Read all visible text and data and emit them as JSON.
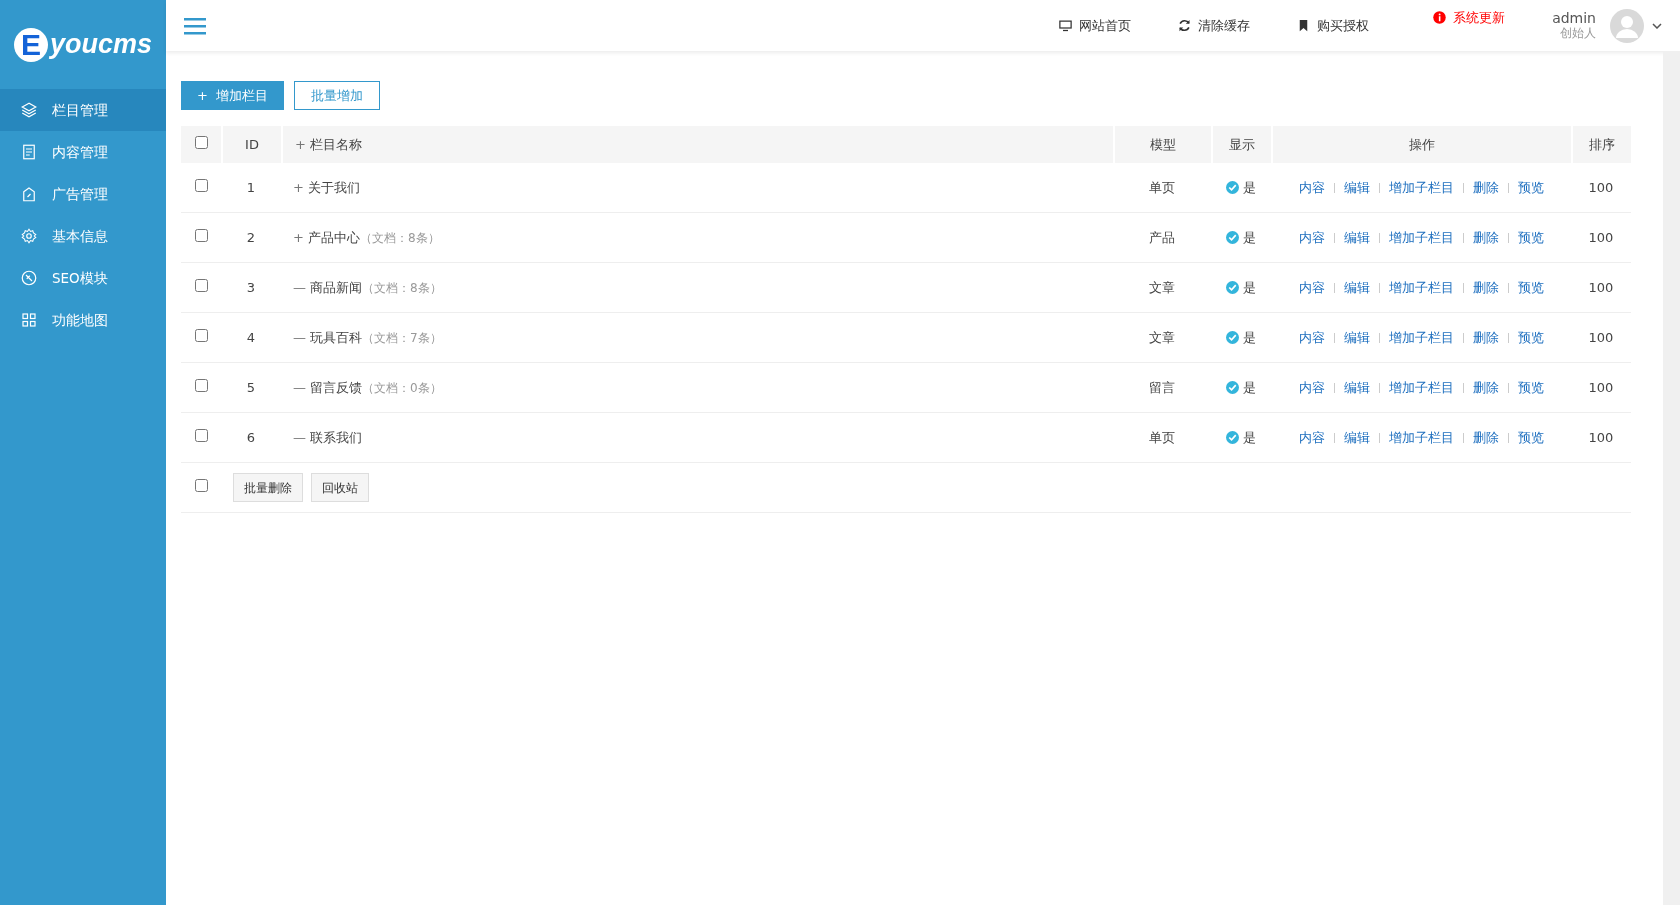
{
  "logo": {
    "initial": "E",
    "text": "youcms"
  },
  "sidebar": {
    "items": [
      {
        "label": "栏目管理",
        "selected": true
      },
      {
        "label": "内容管理",
        "selected": false
      },
      {
        "label": "广告管理",
        "selected": false
      },
      {
        "label": "基本信息",
        "selected": false
      },
      {
        "label": "SEO模块",
        "selected": false
      },
      {
        "label": "功能地图",
        "selected": false
      }
    ]
  },
  "topbar": {
    "links": [
      {
        "label": "网站首页",
        "kind": "normal"
      },
      {
        "label": "清除缓存",
        "kind": "normal"
      },
      {
        "label": "购买授权",
        "kind": "normal"
      },
      {
        "label": "系统更新",
        "kind": "alert"
      }
    ],
    "user": {
      "name": "admin",
      "role": "创始人"
    }
  },
  "toolbar": {
    "buttons": [
      {
        "label": "增加栏目",
        "prefix": "+",
        "kind": "primary"
      },
      {
        "label": "批量增加",
        "kind": "outline"
      }
    ]
  },
  "table": {
    "select_all_checked": false,
    "footer_checked": false,
    "columns": [
      "ID",
      "栏目名称",
      "模型",
      "显示",
      "操作",
      "排序"
    ],
    "name_toggle": "+",
    "rows": [
      {
        "checked": false,
        "id": "1",
        "toggle": "+",
        "name": "关于我们",
        "model": "单页",
        "show": "是",
        "actions": [
          "内容",
          "编辑",
          "增加子栏目",
          "删除",
          "预览"
        ],
        "sort": "100"
      },
      {
        "checked": false,
        "id": "2",
        "toggle": "+",
        "name": "产品中心",
        "count": "（文档：8条）",
        "model": "产品",
        "show": "是",
        "actions": [
          "内容",
          "编辑",
          "增加子栏目",
          "删除",
          "预览"
        ],
        "sort": "100"
      },
      {
        "checked": false,
        "id": "3",
        "toggle": "—",
        "name": "商品新闻",
        "count": "（文档：8条）",
        "model": "文章",
        "show": "是",
        "actions": [
          "内容",
          "编辑",
          "增加子栏目",
          "删除",
          "预览"
        ],
        "sort": "100"
      },
      {
        "checked": false,
        "id": "4",
        "toggle": "—",
        "name": "玩具百科",
        "count": "（文档：7条）",
        "model": "文章",
        "show": "是",
        "actions": [
          "内容",
          "编辑",
          "增加子栏目",
          "删除",
          "预览"
        ],
        "sort": "100"
      },
      {
        "checked": false,
        "id": "5",
        "toggle": "—",
        "name": "留言反馈",
        "count": "（文档：0条）",
        "model": "留言",
        "show": "是",
        "actions": [
          "内容",
          "编辑",
          "增加子栏目",
          "删除",
          "预览"
        ],
        "sort": "100"
      },
      {
        "checked": false,
        "id": "6",
        "toggle": "—",
        "name": "联系我们",
        "model": "单页",
        "show": "是",
        "actions": [
          "内容",
          "编辑",
          "增加子栏目",
          "删除",
          "预览"
        ],
        "sort": "100"
      }
    ],
    "footer_buttons": [
      "批量删除",
      "回收站"
    ]
  }
}
